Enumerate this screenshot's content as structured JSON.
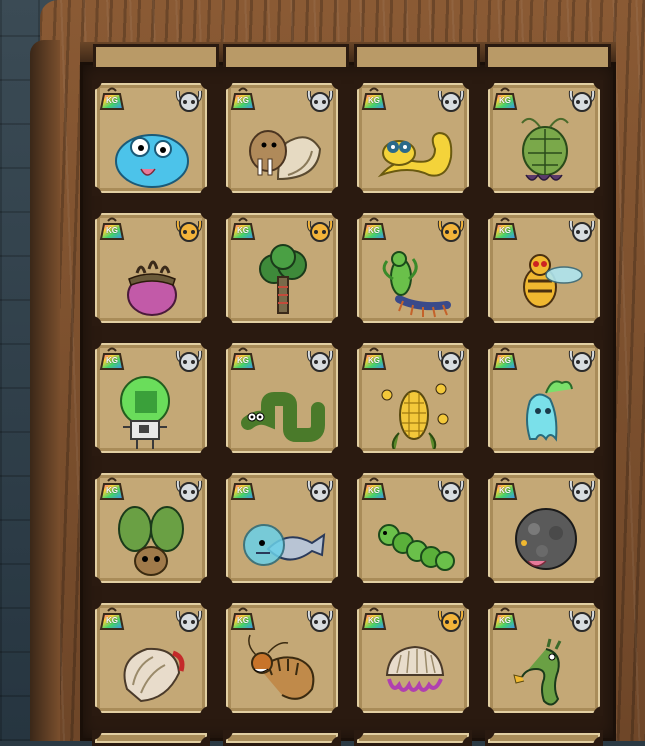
{
  "badge_label": "KG",
  "colors": {
    "cell_bg": "#c4a876",
    "horn_silver": "#d8dde0",
    "horn_gold": "#f3b43a"
  },
  "grid": {
    "rows": [
      [
        {
          "name": "blue-slime-creature",
          "horn": "silver"
        },
        {
          "name": "walrus-snail-creature",
          "horn": "silver"
        },
        {
          "name": "yellow-gecko-creature",
          "horn": "silver"
        },
        {
          "name": "turtle-shell-plant-creature",
          "horn": "silver"
        }
      ],
      [
        {
          "name": "purple-pot-creature",
          "horn": "gold"
        },
        {
          "name": "broccoli-tree-creature",
          "horn": "gold"
        },
        {
          "name": "mantis-centipede-creature",
          "horn": "gold"
        },
        {
          "name": "bee-fly-creature",
          "horn": "silver"
        }
      ],
      [
        {
          "name": "green-dome-robot-creature",
          "horn": "silver"
        },
        {
          "name": "green-snake-creature",
          "horn": "silver"
        },
        {
          "name": "corn-bee-creature",
          "horn": "silver"
        },
        {
          "name": "ghost-flame-creature",
          "horn": "silver"
        }
      ],
      [
        {
          "name": "cactus-bunny-creature",
          "horn": "silver"
        },
        {
          "name": "fish-bubble-creature",
          "horn": "silver"
        },
        {
          "name": "caterpillar-creature",
          "horn": "silver"
        },
        {
          "name": "rock-golem-creature",
          "horn": "silver"
        }
      ],
      [
        {
          "name": "clam-shell-creature",
          "horn": "silver"
        },
        {
          "name": "shrimp-dragon-creature",
          "horn": "silver"
        },
        {
          "name": "shell-jellyfish-creature",
          "horn": "gold"
        },
        {
          "name": "seahorse-creature",
          "horn": "silver"
        }
      ]
    ]
  }
}
